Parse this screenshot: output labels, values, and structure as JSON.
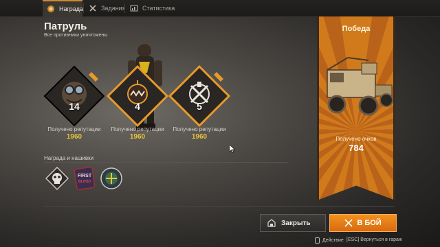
{
  "tabs": [
    {
      "label": "Награда",
      "icon": "award-medal-icon",
      "active": true
    },
    {
      "label": "Задания",
      "icon": "crossed-tools-icon",
      "active": false
    },
    {
      "label": "Статистика",
      "icon": "stats-bar-icon",
      "active": false
    }
  ],
  "mission": {
    "title": "Патруль",
    "subtitle": "Все противники уничтожены"
  },
  "badges": [
    {
      "icon": "goggles-character-icon",
      "number": "14",
      "rep_label": "Получено репутации",
      "rep_value": "1960"
    },
    {
      "icon": "bomb-jaw-faction-icon",
      "number": "4",
      "rep_label": "Получено репутации",
      "rep_value": "1960"
    },
    {
      "icon": "crossed-wrenches-faction-icon",
      "number": "5",
      "rep_label": "Получено репутации",
      "rep_value": "1960"
    }
  ],
  "rewards": {
    "title": "Награда и нашивки",
    "items": [
      {
        "icon": "skull-sticker-icon"
      },
      {
        "icon": "first-blood-patch-icon",
        "text": "FIRST BLOOD"
      },
      {
        "icon": "round-emblem-icon"
      }
    ]
  },
  "victory": {
    "title": "Победа",
    "points_label": "Получено очков",
    "points_value": "784"
  },
  "buttons": {
    "close_label": "Закрыть",
    "fight_label": "В БОЙ"
  },
  "footer": {
    "action_label": "Действие",
    "esc_label": "[ESC] Вернуться в гараж"
  },
  "colors": {
    "accent": "#e8861c",
    "rep_value": "#e8c33a"
  }
}
